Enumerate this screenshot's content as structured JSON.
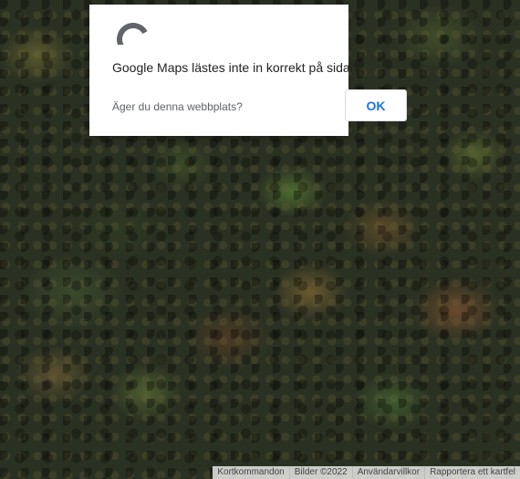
{
  "dialog": {
    "icon": "google-maps-error-arc-icon",
    "title": "Google Maps lästes inte in korrekt på sidan.",
    "subtitle": "Äger du denna webbplats?",
    "ok_label": "OK"
  },
  "attribution": {
    "shortcuts": "Kortkommandon",
    "imagery": "Bilder ©2022",
    "terms": "Användarvillkor",
    "report": "Rapportera ett kartfel"
  },
  "colors": {
    "ok_text": "#1a73e8",
    "icon_gray": "#616468"
  }
}
